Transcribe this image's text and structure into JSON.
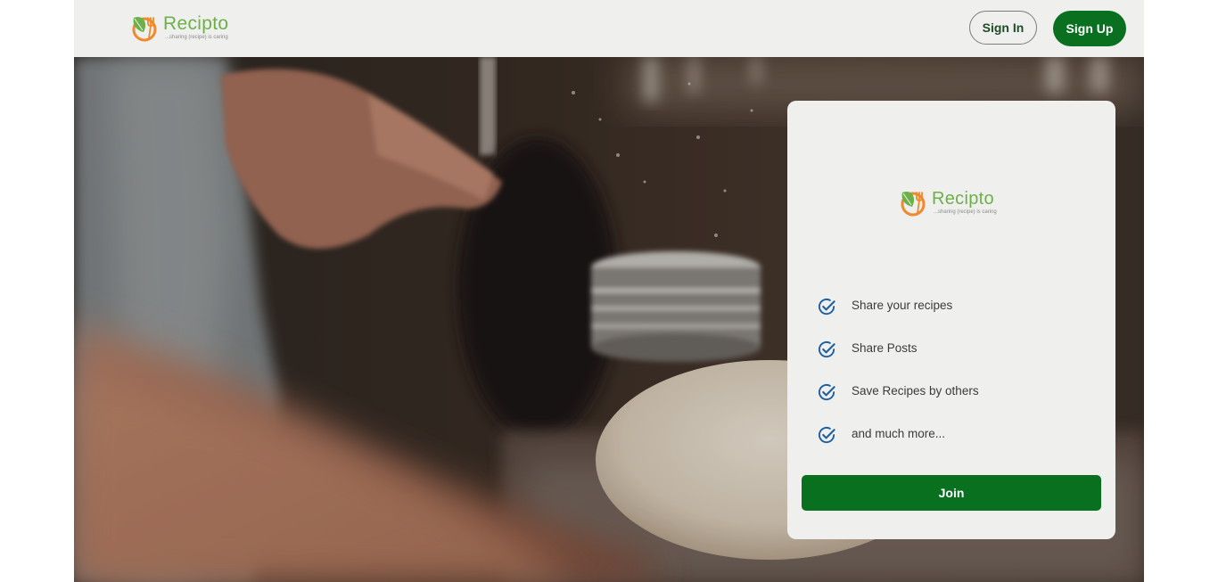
{
  "brand": {
    "name": "Recipto",
    "tagline": "...sharing (recipe) is caring",
    "leaf_color": "#6db04a",
    "fork_color": "#f0892c"
  },
  "header": {
    "sign_in_label": "Sign In",
    "sign_up_label": "Sign Up"
  },
  "hero": {
    "image": "baker-dusting-flour-on-dough"
  },
  "card": {
    "features": [
      {
        "icon": "check-circle-icon",
        "label": "Share your recipes"
      },
      {
        "icon": "check-circle-icon",
        "label": "Share Posts"
      },
      {
        "icon": "check-circle-icon",
        "label": "Save Recipes by others"
      },
      {
        "icon": "check-circle-icon",
        "label": "and much more..."
      }
    ],
    "join_label": "Join"
  },
  "colors": {
    "primary_green": "#08701f",
    "check_blue": "#1f5f9e",
    "header_bg": "#efefed"
  }
}
